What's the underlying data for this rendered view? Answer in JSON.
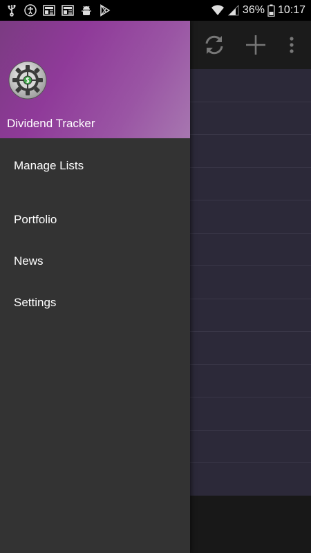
{
  "status_bar": {
    "left_icons": [
      "usb-icon",
      "accessibility-icon",
      "news-icon",
      "news-icon",
      "android-debug-icon",
      "play-store-icon"
    ],
    "battery_percent": "36%",
    "time": "10:17"
  },
  "drawer": {
    "app_title": "Dividend Tracker",
    "menu": [
      {
        "label": "Manage Lists"
      },
      {
        "label": "Portfolio"
      },
      {
        "label": "News"
      },
      {
        "label": "Settings"
      }
    ]
  },
  "colors": {
    "drawer_bg": "#333333",
    "header_gradient_start": "#7b3b82",
    "header_gradient_end": "#a777b0",
    "list_bg": "#2c2939",
    "toolbar_bg": "#1b1b1b"
  }
}
